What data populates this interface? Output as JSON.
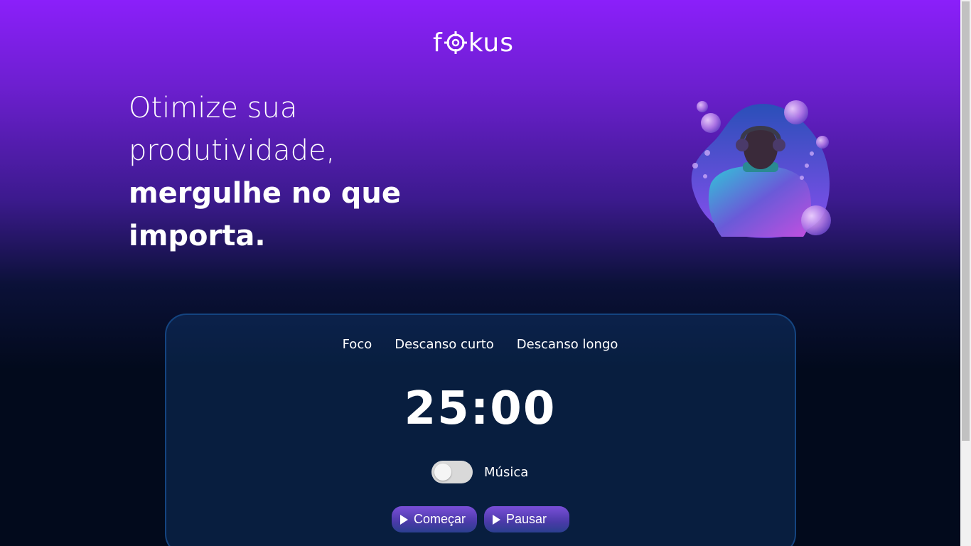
{
  "header": {
    "logo_prefix": "f",
    "logo_suffix": "kus"
  },
  "hero": {
    "line1": "Otimize sua",
    "line2": "produtividade,",
    "line3": "mergulhe no que",
    "line4": "importa."
  },
  "tabs": [
    {
      "label": "Foco",
      "active": true
    },
    {
      "label": "Descanso curto",
      "active": false
    },
    {
      "label": "Descanso longo",
      "active": false
    }
  ],
  "timer": {
    "display": "25:00"
  },
  "music": {
    "label": "Música",
    "enabled": false
  },
  "controls": {
    "start_label": "Começar",
    "pause_label": "Pausar"
  },
  "colors": {
    "accent_purple": "#8b1ffa",
    "card_border": "#144480",
    "background_dark": "#020a1c"
  },
  "icons": {
    "logo_target": "target-icon",
    "play": "play-icon"
  }
}
